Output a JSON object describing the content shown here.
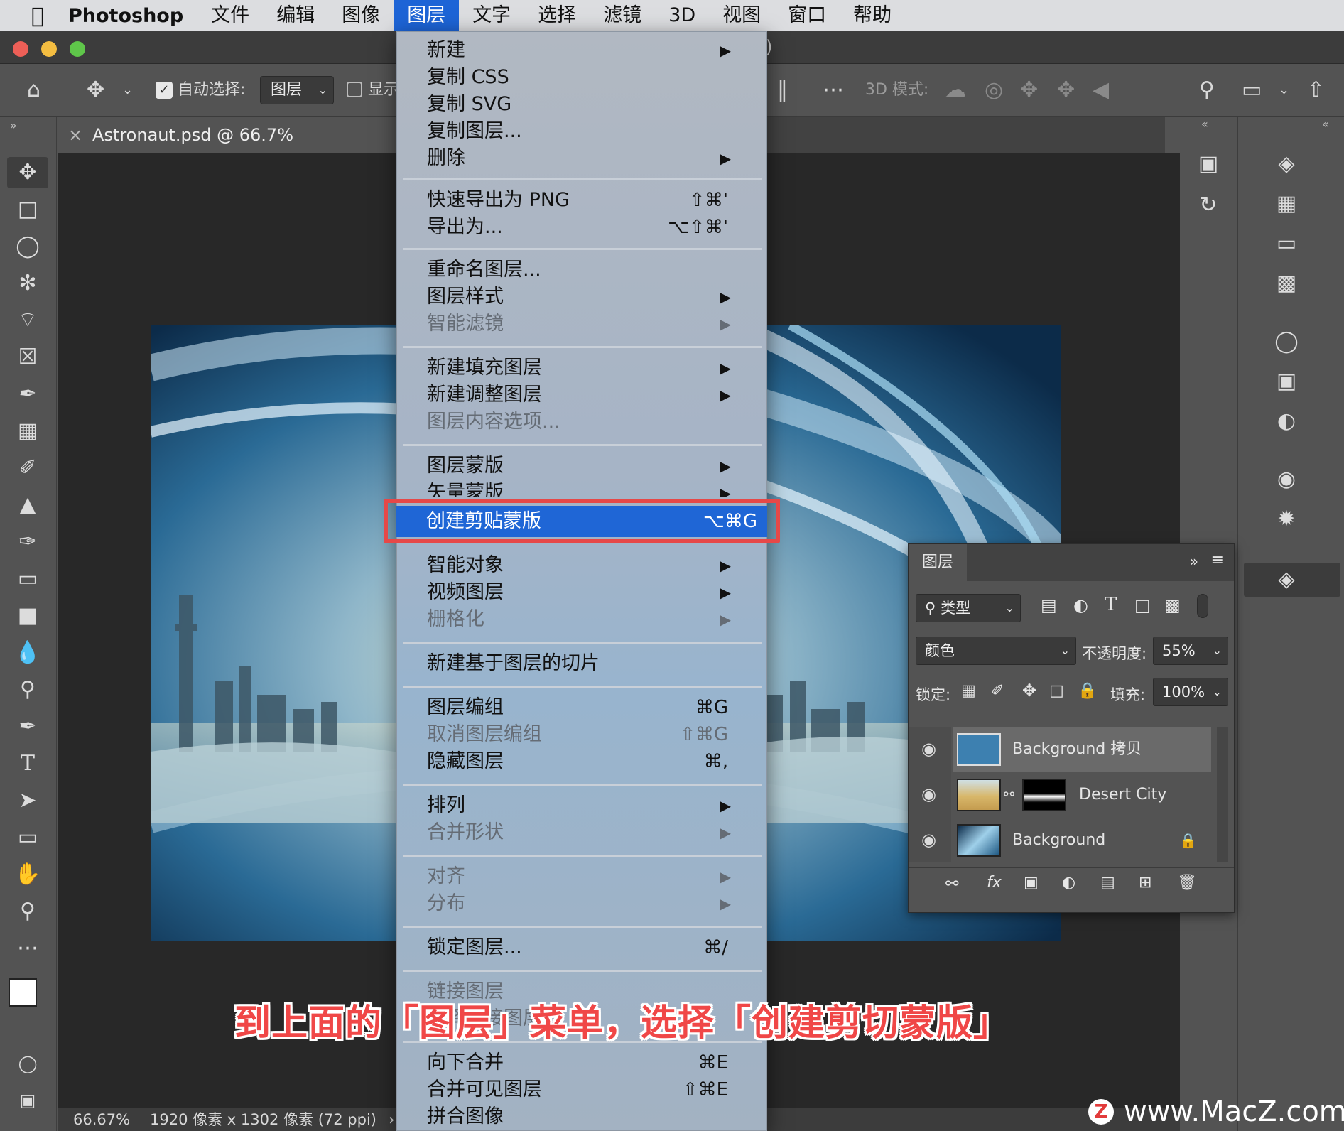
{
  "menubar": {
    "app": "Photoshop",
    "items": [
      "文件",
      "编辑",
      "图像",
      "图层",
      "文字",
      "选择",
      "滤镜",
      "3D",
      "视图",
      "窗口",
      "帮助"
    ],
    "active_index": 3
  },
  "options_bar": {
    "auto_select_label": "自动选择:",
    "auto_select_value": "图层",
    "show_label": "显示",
    "mode_3d_label": "3D 模式:"
  },
  "document": {
    "tab_title": "Astronaut.psd @ 66.7% (Background",
    "title_suffix": ")"
  },
  "status": {
    "zoom": "66.67%",
    "info": "1920 像素 x 1302 像素 (72 ppi)",
    "arrow": "›"
  },
  "layer_menu": {
    "items": [
      {
        "label": "新建",
        "arrow": "▶"
      },
      {
        "label": "复制 CSS"
      },
      {
        "label": "复制 SVG"
      },
      {
        "label": "复制图层..."
      },
      {
        "label": "删除",
        "arrow": "▶"
      },
      {
        "label": "快速导出为 PNG",
        "shortcut": "⇧⌘'"
      },
      {
        "label": "导出为...",
        "shortcut": "⌥⇧⌘'"
      },
      {
        "label": "重命名图层..."
      },
      {
        "label": "图层样式",
        "arrow": "▶"
      },
      {
        "label": "智能滤镜",
        "arrow": "▶",
        "disabled": true
      },
      {
        "label": "新建填充图层",
        "arrow": "▶"
      },
      {
        "label": "新建调整图层",
        "arrow": "▶"
      },
      {
        "label": "图层内容选项...",
        "disabled": true
      },
      {
        "label": "图层蒙版",
        "arrow": "▶"
      },
      {
        "label": "矢量蒙版",
        "arrow": "▶"
      },
      {
        "label": "创建剪贴蒙版",
        "shortcut": "⌥⌘G",
        "highlighted": true
      },
      {
        "label": "智能对象",
        "arrow": "▶"
      },
      {
        "label": "视频图层",
        "arrow": "▶"
      },
      {
        "label": "栅格化",
        "arrow": "▶",
        "disabled": true
      },
      {
        "label": "新建基于图层的切片"
      },
      {
        "label": "图层编组",
        "shortcut": "⌘G"
      },
      {
        "label": "取消图层编组",
        "shortcut": "⇧⌘G",
        "disabled": true
      },
      {
        "label": "隐藏图层",
        "shortcut": "⌘,"
      },
      {
        "label": "排列",
        "arrow": "▶"
      },
      {
        "label": "合并形状",
        "arrow": "▶",
        "disabled": true
      },
      {
        "label": "对齐",
        "arrow": "▶",
        "disabled": true
      },
      {
        "label": "分布",
        "arrow": "▶",
        "disabled": true
      },
      {
        "label": "锁定图层...",
        "shortcut": "⌘/"
      },
      {
        "label": "链接图层",
        "disabled": true
      },
      {
        "label": "选择链接图层",
        "disabled": true
      },
      {
        "label": "向下合并",
        "shortcut": "⌘E"
      },
      {
        "label": "合并可见图层",
        "shortcut": "⇧⌘E"
      },
      {
        "label": "拼合图像"
      }
    ]
  },
  "layers_panel": {
    "tab": "图层",
    "filter_kind": "类型",
    "blend_mode": "颜色",
    "opacity_label": "不透明度:",
    "opacity_value": "55%",
    "lock_label": "锁定:",
    "fill_label": "填充:",
    "fill_value": "100%",
    "layers": [
      {
        "name": "Background 拷贝",
        "selected": true
      },
      {
        "name": "Desert City"
      },
      {
        "name": "Background",
        "locked": true
      }
    ],
    "footer_fx": "fx"
  },
  "caption": "到上面的「图层」菜单，选择「创建剪切蒙版」",
  "watermark": {
    "logo": "Z",
    "text": "www.MacZ.com"
  },
  "colors": {
    "menu_highlight": "#1f66d6",
    "callout_red": "#e64848",
    "caption_red": "#f04747",
    "app_bg": "#535353"
  },
  "icons": [
    "apple-icon",
    "home-icon",
    "move-icon",
    "search-icon",
    "eye-icon",
    "lock-icon",
    "trash-icon",
    "layers-icon"
  ]
}
